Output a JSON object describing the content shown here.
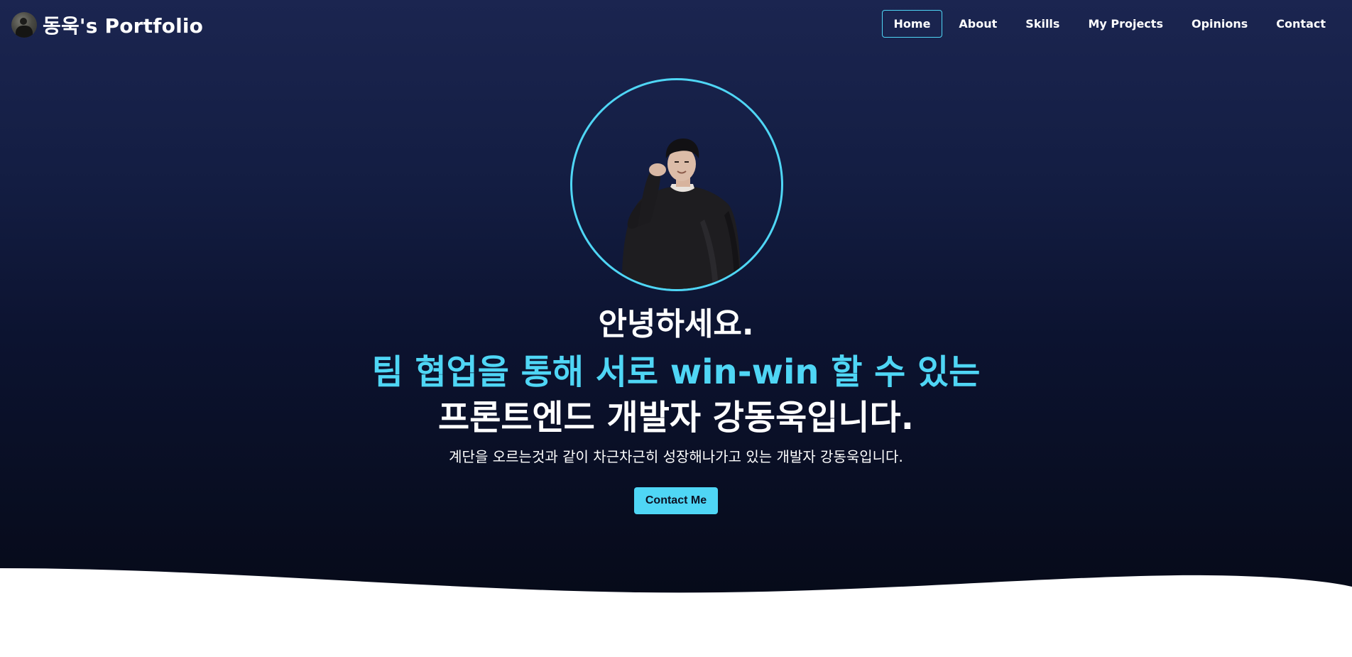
{
  "navbar": {
    "brand_title": "동욱's Portfolio",
    "items": [
      {
        "label": "Home",
        "active": true
      },
      {
        "label": "About",
        "active": false
      },
      {
        "label": "Skills",
        "active": false
      },
      {
        "label": "My Projects",
        "active": false
      },
      {
        "label": "Opinions",
        "active": false
      },
      {
        "label": "Contact",
        "active": false
      }
    ]
  },
  "hero": {
    "greeting": "안녕하세요.",
    "tagline": "팀 협업을 통해 서로 win-win 할 수 있는",
    "role": "프론트엔드 개발자 강동욱입니다.",
    "subtext": "계단을 오르는것과 같이 차근차근히 성장해나가고 있는 개발자 강동욱입니다.",
    "cta_label": "Contact Me"
  },
  "colors": {
    "accent": "#4fd6f5",
    "hero_top": "#1b2550",
    "hero_bottom": "#060a18",
    "text": "#ffffff"
  }
}
